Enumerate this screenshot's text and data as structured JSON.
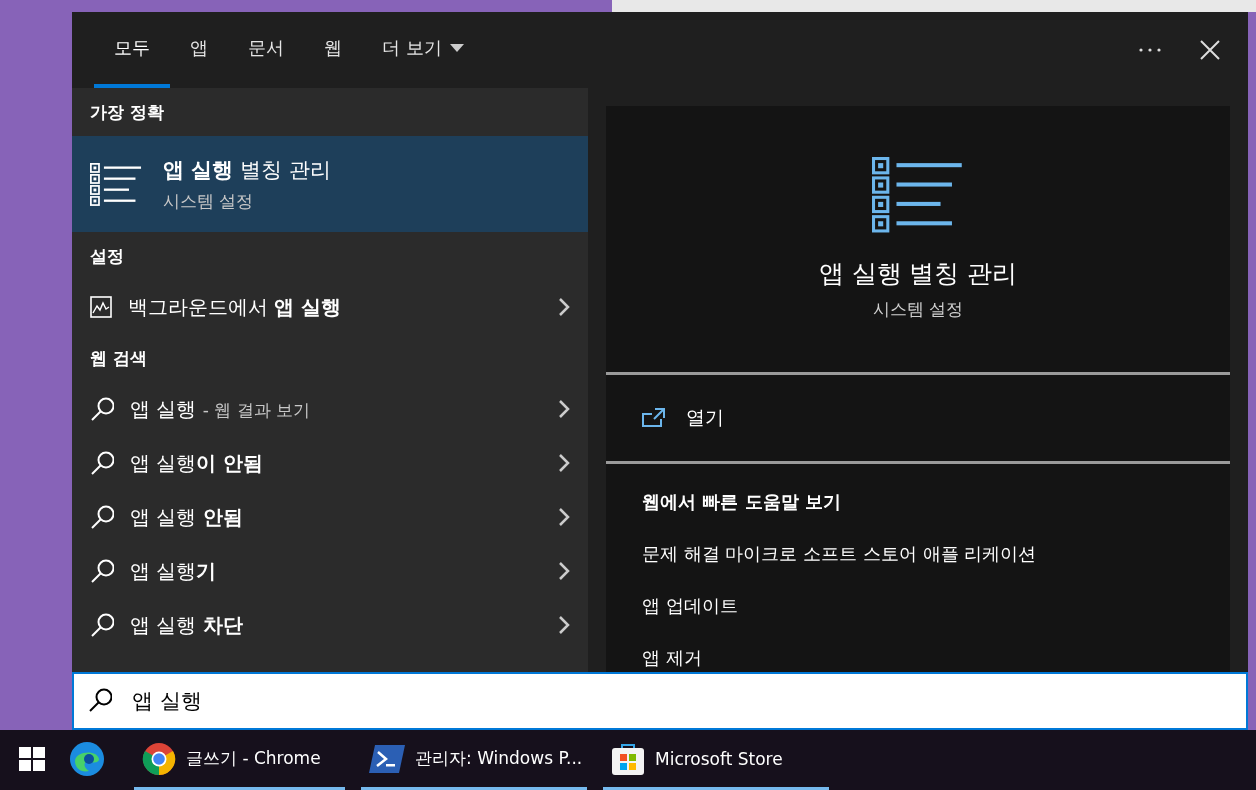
{
  "tabs": [
    {
      "label": "모두",
      "selected": true
    },
    {
      "label": "앱",
      "selected": false
    },
    {
      "label": "문서",
      "selected": false
    },
    {
      "label": "웹",
      "selected": false
    },
    {
      "label": "더 보기",
      "selected": false,
      "kind": "dropdown"
    }
  ],
  "best_match": {
    "heading": "가장 정확",
    "title": "**앱 실행** 별칭 관리",
    "subtitle": "시스템 설정",
    "selected": true
  },
  "settings": {
    "heading": "설정",
    "items": [
      {
        "text": "백그라운드에서 **앱 실행**"
      }
    ]
  },
  "web_search": {
    "heading": "웹 검색",
    "items": [
      {
        "text": "앱 실행",
        "suffix": "- 웹 결과 보기"
      },
      {
        "text": "앱 실행**이 안됨**"
      },
      {
        "text": "앱 실행 **안됨**"
      },
      {
        "text": "앱 실행**기**"
      },
      {
        "text": "앱 실행 **차단**"
      }
    ]
  },
  "preview": {
    "title": "앱 실행 별칭 관리",
    "subtitle": "시스템 설정",
    "open_label": "열기",
    "help_heading": "웹에서 빠른 도움말 보기",
    "help_links": [
      "문제 해결 마이크로 소프트 스토어 애플 리케이션",
      "앱 업데이트",
      "앱 제거"
    ]
  },
  "search": {
    "value": "앱 실행"
  },
  "taskbar": [
    {
      "kind": "start"
    },
    {
      "kind": "edge",
      "running": false
    },
    {
      "kind": "chrome",
      "label": "글쓰기 - Chrome",
      "running": true
    },
    {
      "kind": "powershell",
      "label": "관리자: Windows P...",
      "running": true
    },
    {
      "kind": "store",
      "label": "Microsoft Store",
      "running": true
    }
  ]
}
